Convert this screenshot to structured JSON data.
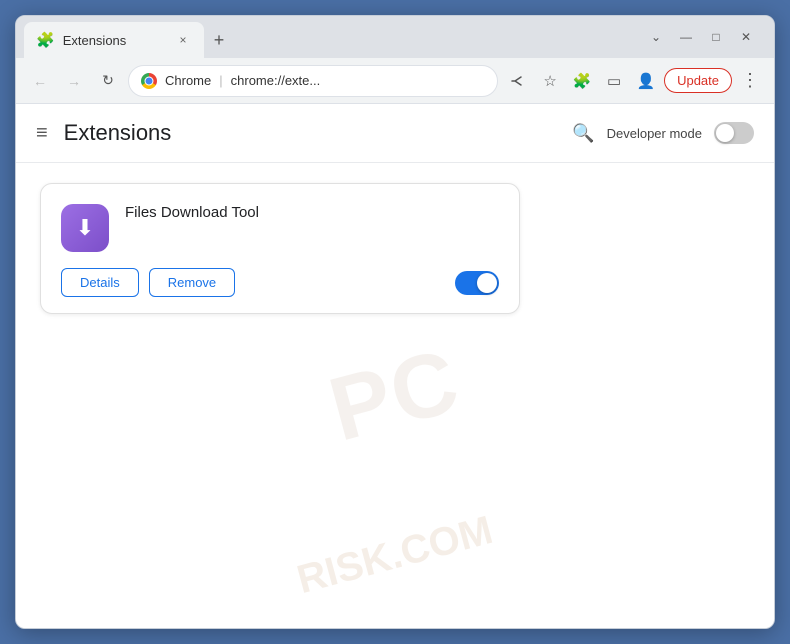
{
  "browser": {
    "tab": {
      "title": "Extensions",
      "close_icon": "×",
      "new_tab_icon": "+"
    },
    "window_controls": {
      "chevron": "⌄",
      "minimize": "—",
      "maximize": "□",
      "close": "✕"
    },
    "toolbar": {
      "back_icon": "←",
      "forward_icon": "→",
      "reload_icon": "↻",
      "chrome_label": "Chrome",
      "address": "chrome://exte...",
      "share_icon": "⎋",
      "star_icon": "☆",
      "puzzle_icon": "🧩",
      "sidebar_icon": "▭",
      "profile_icon": "👤",
      "update_label": "Update",
      "menu_icon": "⋮"
    },
    "page": {
      "hamburger_icon": "≡",
      "title": "Extensions",
      "search_icon": "🔍",
      "developer_mode_label": "Developer mode",
      "watermark_line1": "PC",
      "watermark_line2": "RISK.COM",
      "extension": {
        "name": "Files Download Tool",
        "details_label": "Details",
        "remove_label": "Remove"
      }
    }
  }
}
